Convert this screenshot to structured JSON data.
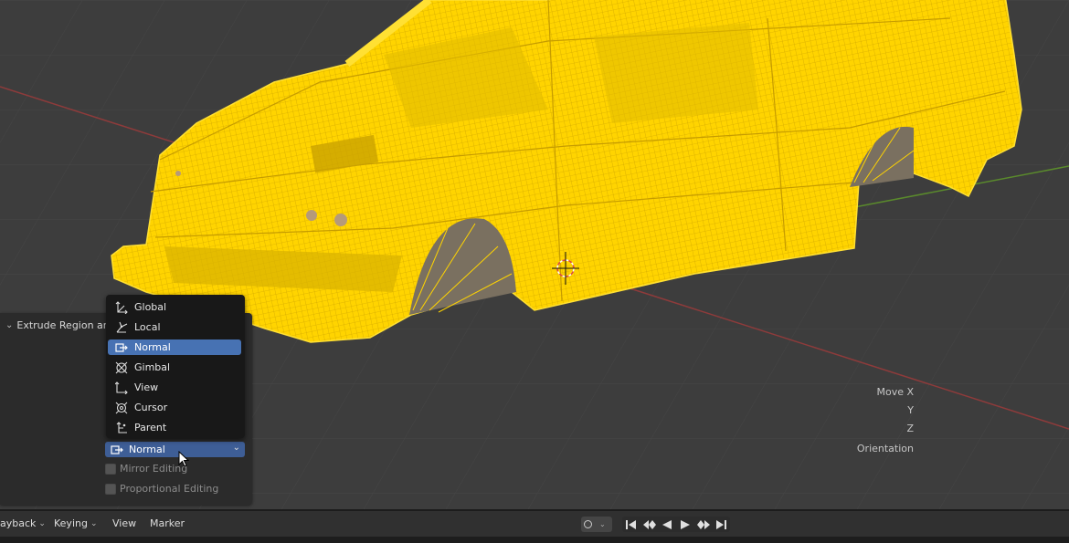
{
  "operator_panel": {
    "title": "Extrude Region an",
    "move_x_label": "Move X",
    "y_label": "Y",
    "z_label": "Z",
    "orientation_label": "Orientation",
    "orientation_value": "Normal",
    "mirror_editing_label": "Mirror Editing",
    "proportional_editing_label": "Proportional Editing"
  },
  "orientation_menu": {
    "items": [
      {
        "label": "Global",
        "icon": "global-axes-icon"
      },
      {
        "label": "Local",
        "icon": "local-axes-icon"
      },
      {
        "label": "Normal",
        "icon": "normal-axes-icon",
        "selected": true
      },
      {
        "label": "Gimbal",
        "icon": "gimbal-icon"
      },
      {
        "label": "View",
        "icon": "view-axes-icon"
      },
      {
        "label": "Cursor",
        "icon": "cursor-axes-icon"
      },
      {
        "label": "Parent",
        "icon": "parent-axes-icon"
      }
    ]
  },
  "timeline": {
    "playback_label": "ayback",
    "keying_label": "Keying",
    "view_label": "View",
    "marker_label": "Marker"
  },
  "colors": {
    "wireframe": "#ffd400",
    "wire_line": "#c9a300",
    "menu_highlight": "#4772b3",
    "field_highlight": "#3e5e96",
    "x_axis": "#8e3b3b",
    "y_axis": "#5a8a2c"
  }
}
